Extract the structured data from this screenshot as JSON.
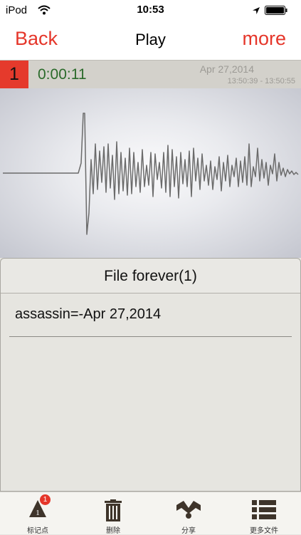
{
  "status_bar": {
    "carrier": "iPod",
    "time": "10:53"
  },
  "nav": {
    "back_label": "Back",
    "title": "Play",
    "more_label": "more"
  },
  "recording": {
    "index": "1",
    "duration": "0:00:11",
    "date": "Apr 27,2014",
    "time_range": "13:50:39 - 13:50:55"
  },
  "file_list": {
    "header": "File forever(1)",
    "items": [
      {
        "name": "assassin=-Apr 27,2014"
      }
    ]
  },
  "tab_bar": {
    "items": [
      {
        "label": "标记点",
        "icon": "marker-icon",
        "badge": "1",
        "marker_number": "1"
      },
      {
        "label": "删除",
        "icon": "trash-icon"
      },
      {
        "label": "分享",
        "icon": "share-icon"
      },
      {
        "label": "更多文件",
        "icon": "list-icon"
      }
    ]
  },
  "colors": {
    "accent": "#e5362a",
    "duration_text": "#2a6a2a",
    "waveform_stroke": "#6b6b6b"
  }
}
